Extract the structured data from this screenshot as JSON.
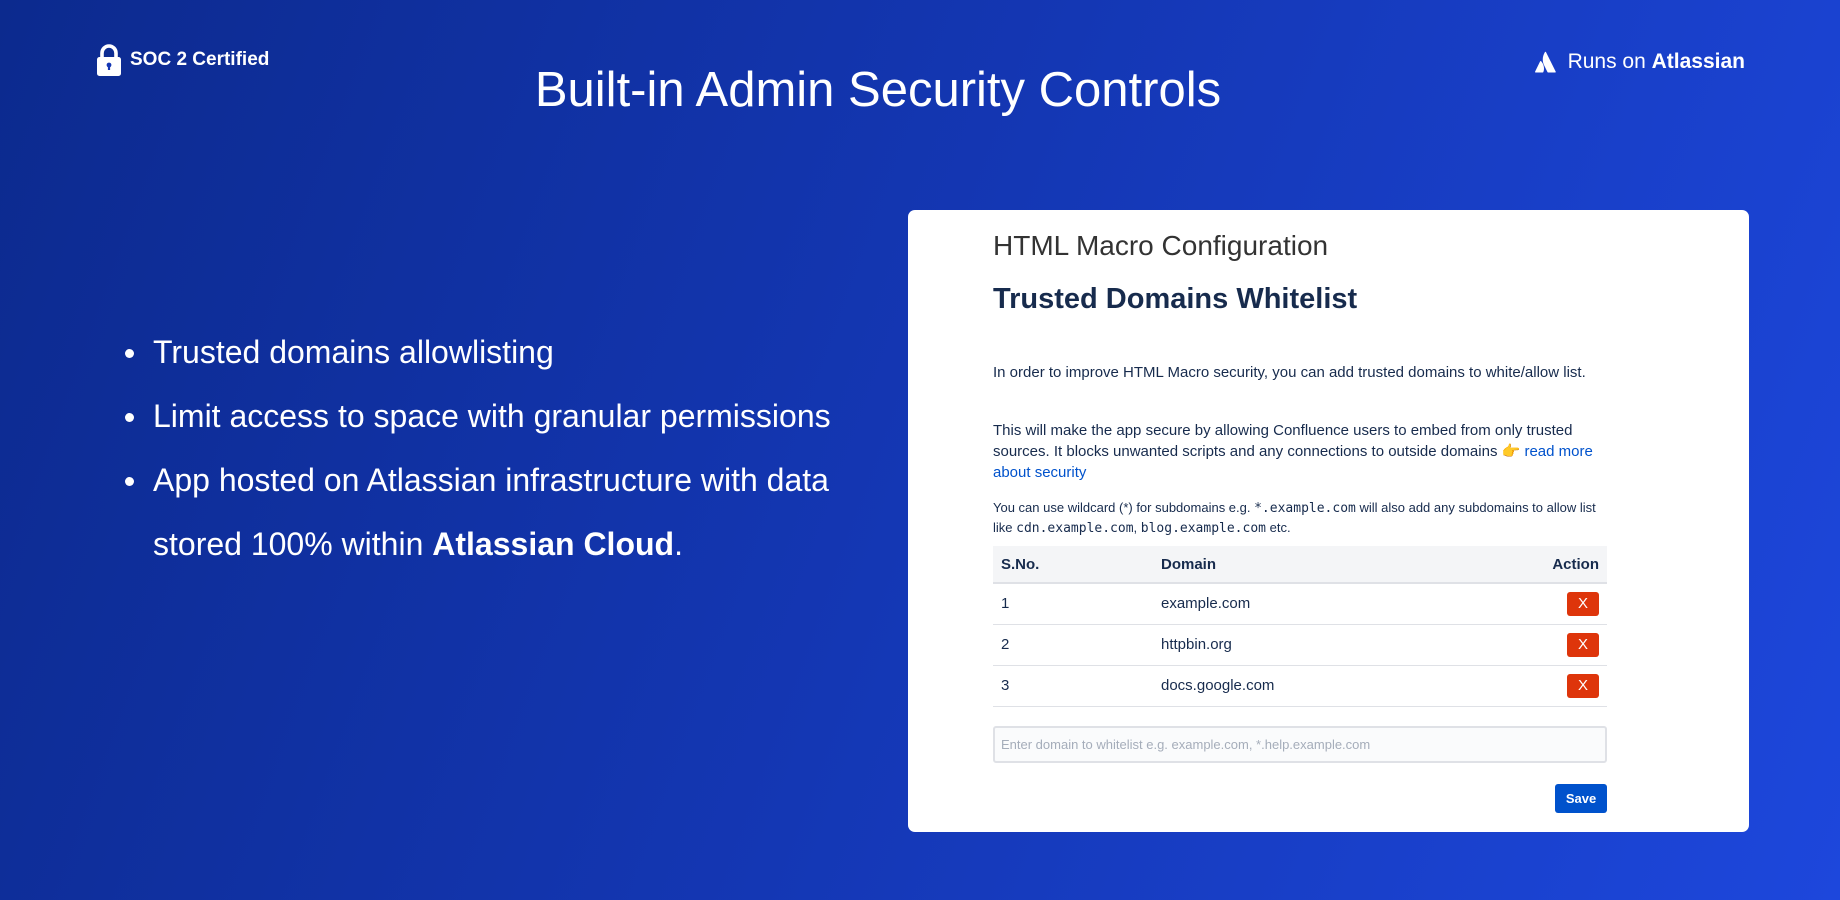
{
  "header": {
    "badge_text": "SOC 2 Certified",
    "badge_icon": "lock-icon",
    "title": "Built-in Admin Security Controls",
    "runs_on_prefix": "Runs on",
    "runs_on_brand": "Atlassian",
    "runs_on_icon": "atlassian-logo-icon"
  },
  "features": {
    "items": [
      "Trusted domains allowlisting",
      "Limit access to space with granular permissions"
    ],
    "item3_prefix": "App hosted on Atlassian infrastructure with data stored 100% within ",
    "item3_bold": "Atlassian Cloud",
    "item3_suffix": "."
  },
  "card": {
    "config_title": "HTML Macro Configuration",
    "whitelist_title": "Trusted Domains Whitelist",
    "para1": "In order to improve HTML Macro security, you can add trusted domains to white/allow list.",
    "para2_text": "This will make the app secure by allowing Confluence users to embed from only trusted sources. It blocks unwanted scripts and any connections to outside domains 👉 ",
    "para2_link": "read more about security",
    "para3": {
      "t1": "You can use wildcard (*) for subdomains e.g. ",
      "code1": "*.example.com",
      "t2": " will also add any subdomains to allow list like ",
      "code2": "cdn.example.com",
      "t3": ", ",
      "code3": "blog.example.com",
      "t4": " etc."
    },
    "table": {
      "headers": [
        "S.No.",
        "Domain",
        "Action"
      ],
      "rows": [
        {
          "sno": "1",
          "domain": "example.com",
          "action": "X"
        },
        {
          "sno": "2",
          "domain": "httpbin.org",
          "action": "X"
        },
        {
          "sno": "3",
          "domain": "docs.google.com",
          "action": "X"
        }
      ]
    },
    "input_placeholder": "Enter domain to whitelist e.g. example.com, *.help.example.com",
    "input_value": "",
    "save_label": "Save"
  },
  "colors": {
    "background_start": "#0c2a8e",
    "background_end": "#1d47dc",
    "delete_button": "#de350b",
    "save_button": "#0052cc",
    "link": "#0052cc"
  }
}
